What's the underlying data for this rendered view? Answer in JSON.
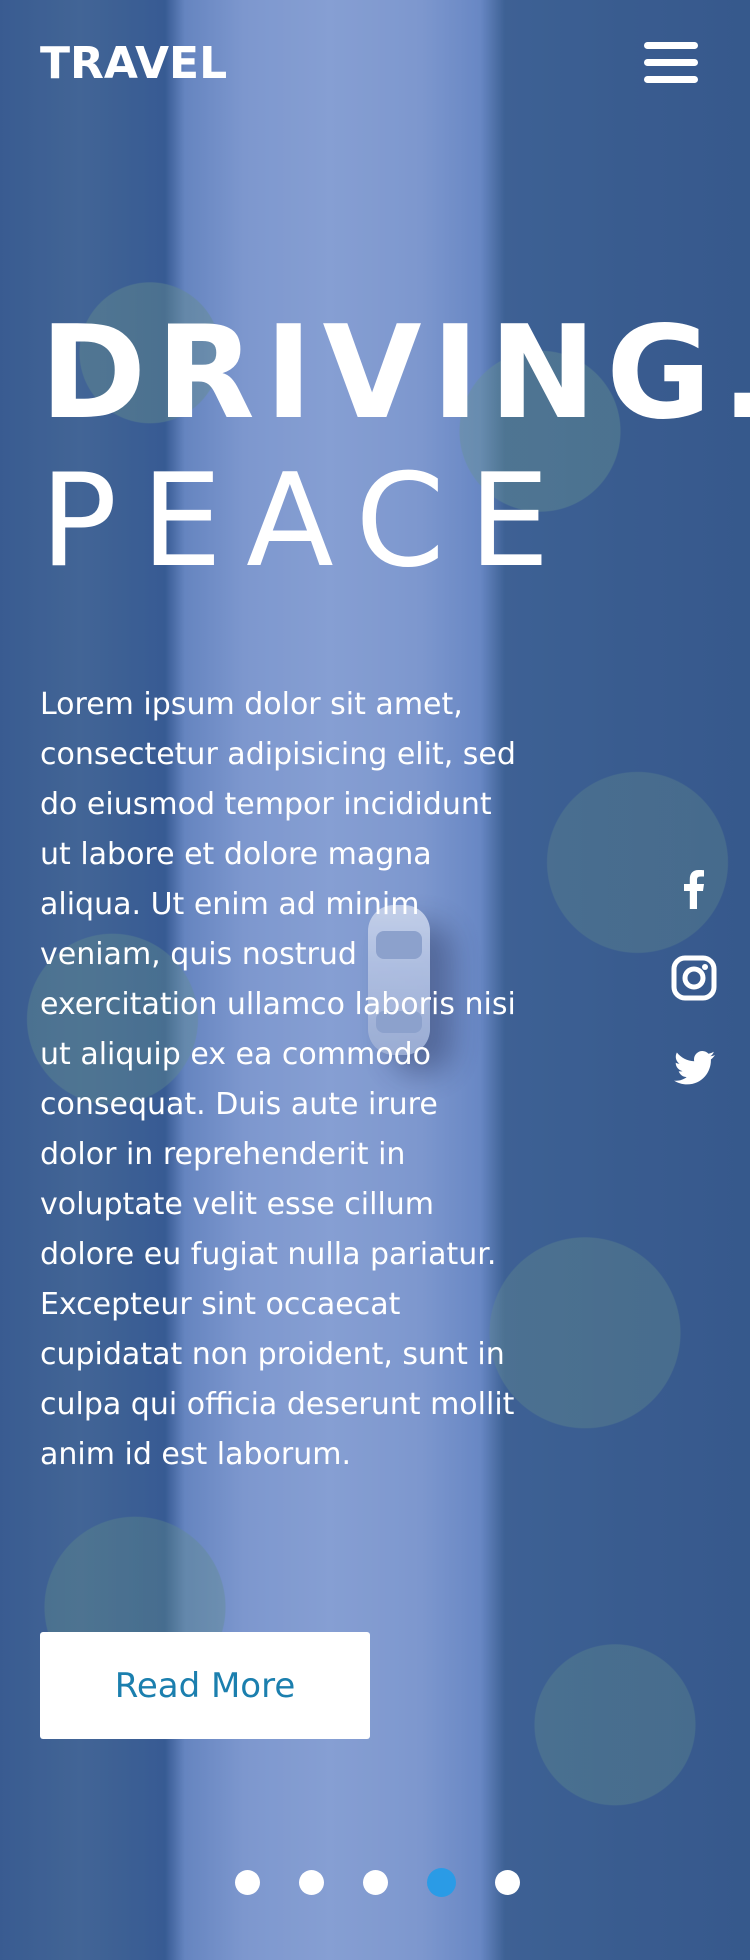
{
  "header": {
    "brand": "TRAVEL",
    "menu_icon": "hamburger-menu-icon"
  },
  "hero": {
    "headline_line1": "DRIVING.",
    "headline_line2": "PEACE",
    "body": "Lorem ipsum dolor sit amet, consectetur adipisicing elit, sed do eiusmod tempor incididunt ut labore et dolore magna aliqua. Ut enim ad minim veniam, quis nostrud exercitation ullamco laboris nisi ut aliquip ex ea commodo consequat. Duis aute irure dolor in reprehenderit in voluptate velit esse cillum dolore eu fugiat nulla pariatur. Excepteur sint occaecat cupidatat non proident, sunt in culpa qui officia deserunt mollit anim id est laborum.",
    "cta_label": "Read More"
  },
  "social": [
    {
      "icon": "facebook-icon"
    },
    {
      "icon": "instagram-icon"
    },
    {
      "icon": "twitter-icon"
    }
  ],
  "carousel": {
    "total_slides": 5,
    "active_slide": 4
  },
  "colors": {
    "text": "#ffffff",
    "cta_text": "#1b7fae",
    "active_dot": "#2a9be6",
    "overlay": "#2d55aa"
  }
}
